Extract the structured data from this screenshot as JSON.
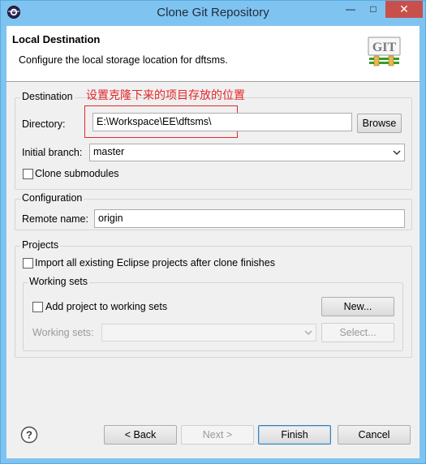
{
  "window": {
    "title": "Clone Git Repository",
    "minimize_glyph": "—",
    "maximize_glyph": "□",
    "close_glyph": "✕"
  },
  "header": {
    "title": "Local Destination",
    "description": "Configure the local storage location for dftsms.",
    "logo_text": "GIT"
  },
  "destination": {
    "group_label": "Destination",
    "annotation": "设置克隆下来的项目存放的位置",
    "directory_label": "Directory:",
    "directory_value": "E:\\Workspace\\EE\\dftsms\\",
    "browse_label": "Browse",
    "initial_branch_label": "Initial branch:",
    "initial_branch_value": "master",
    "clone_submodules_label": "Clone submodules",
    "clone_submodules_checked": false
  },
  "configuration": {
    "group_label": "Configuration",
    "remote_name_label": "Remote name:",
    "remote_name_value": "origin"
  },
  "projects": {
    "group_label": "Projects",
    "import_label": "Import all existing Eclipse projects after clone finishes",
    "import_checked": false,
    "working_sets": {
      "group_label": "Working sets",
      "add_label": "Add project to working sets",
      "add_checked": false,
      "new_label": "New...",
      "sets_label": "Working sets:",
      "sets_value": "",
      "select_label": "Select..."
    }
  },
  "footer": {
    "help_glyph": "?",
    "back_label": "< Back",
    "next_label": "Next >",
    "finish_label": "Finish",
    "cancel_label": "Cancel"
  },
  "colors": {
    "titlebar": "#7fc3f1",
    "close_button": "#c7504b",
    "annotation": "#e5272b"
  }
}
